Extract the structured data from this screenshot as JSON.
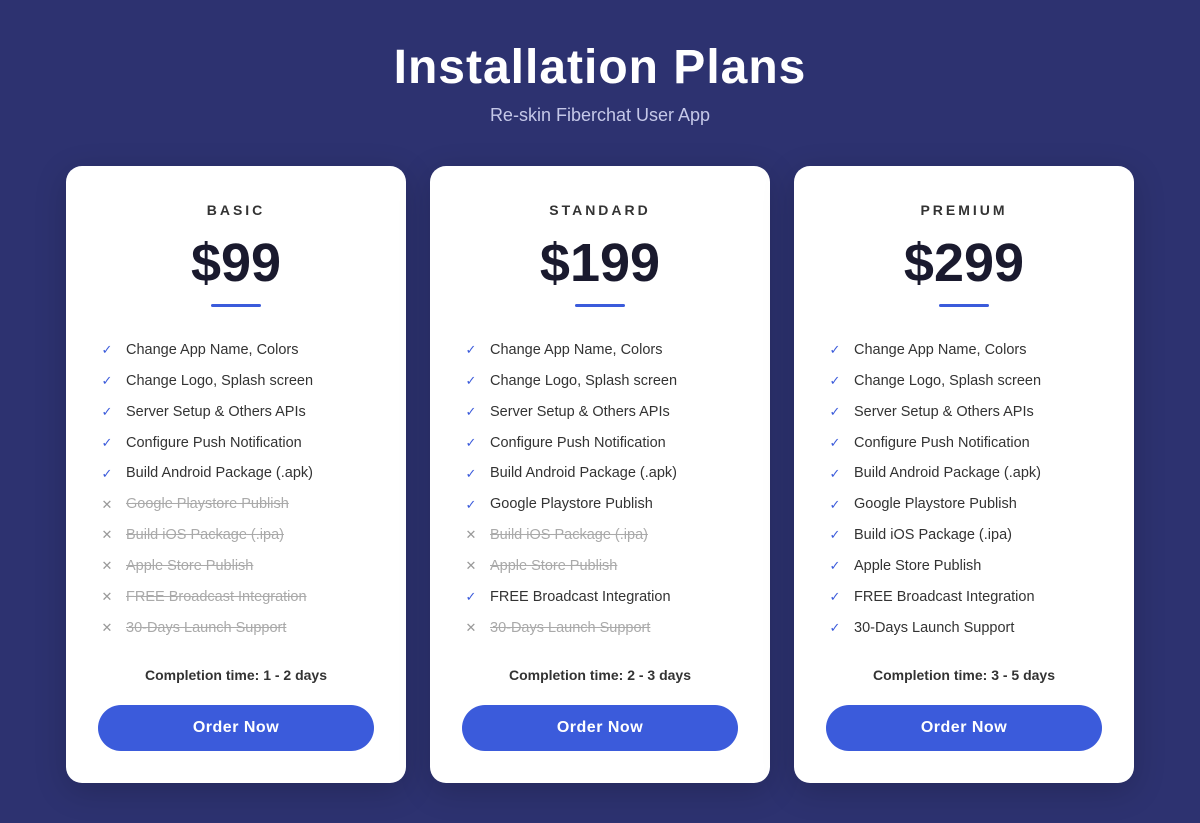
{
  "header": {
    "title": "Installation Plans",
    "subtitle": "Re-skin Fiberchat User App"
  },
  "plans": [
    {
      "id": "basic",
      "name": "BASIC",
      "price": "$99",
      "features": [
        {
          "text": "Change App Name, Colors",
          "included": true
        },
        {
          "text": "Change Logo, Splash screen",
          "included": true
        },
        {
          "text": "Server Setup & Others APIs",
          "included": true
        },
        {
          "text": "Configure Push Notification",
          "included": true
        },
        {
          "text": "Build Android Package (.apk)",
          "included": true
        },
        {
          "text": "Google Playstore Publish",
          "included": false
        },
        {
          "text": "Build iOS Package (.ipa)",
          "included": false
        },
        {
          "text": "Apple Store Publish",
          "included": false
        },
        {
          "text": "FREE Broadcast Integration",
          "included": false
        },
        {
          "text": "30-Days Launch Support",
          "included": false
        }
      ],
      "completion": "Completion time: 1 - 2 days",
      "btn_label": "Order Now"
    },
    {
      "id": "standard",
      "name": "STANDARD",
      "price": "$199",
      "features": [
        {
          "text": "Change App Name, Colors",
          "included": true
        },
        {
          "text": "Change Logo, Splash screen",
          "included": true
        },
        {
          "text": "Server Setup & Others APIs",
          "included": true
        },
        {
          "text": "Configure Push Notification",
          "included": true
        },
        {
          "text": "Build Android Package (.apk)",
          "included": true
        },
        {
          "text": "Google Playstore Publish",
          "included": true
        },
        {
          "text": "Build iOS Package (.ipa)",
          "included": false
        },
        {
          "text": "Apple Store Publish",
          "included": false
        },
        {
          "text": "FREE Broadcast Integration",
          "included": true
        },
        {
          "text": "30-Days Launch Support",
          "included": false
        }
      ],
      "completion": "Completion time: 2 - 3 days",
      "btn_label": "Order Now"
    },
    {
      "id": "premium",
      "name": "PREMIUM",
      "price": "$299",
      "features": [
        {
          "text": "Change App Name, Colors",
          "included": true
        },
        {
          "text": "Change Logo, Splash screen",
          "included": true
        },
        {
          "text": "Server Setup & Others APIs",
          "included": true
        },
        {
          "text": "Configure Push Notification",
          "included": true
        },
        {
          "text": "Build Android Package (.apk)",
          "included": true
        },
        {
          "text": "Google Playstore Publish",
          "included": true
        },
        {
          "text": "Build iOS Package (.ipa)",
          "included": true
        },
        {
          "text": "Apple Store Publish",
          "included": true
        },
        {
          "text": "FREE Broadcast Integration",
          "included": true
        },
        {
          "text": "30-Days Launch Support",
          "included": true
        }
      ],
      "completion": "Completion time: 3 - 5 days",
      "btn_label": "Order Now"
    }
  ]
}
